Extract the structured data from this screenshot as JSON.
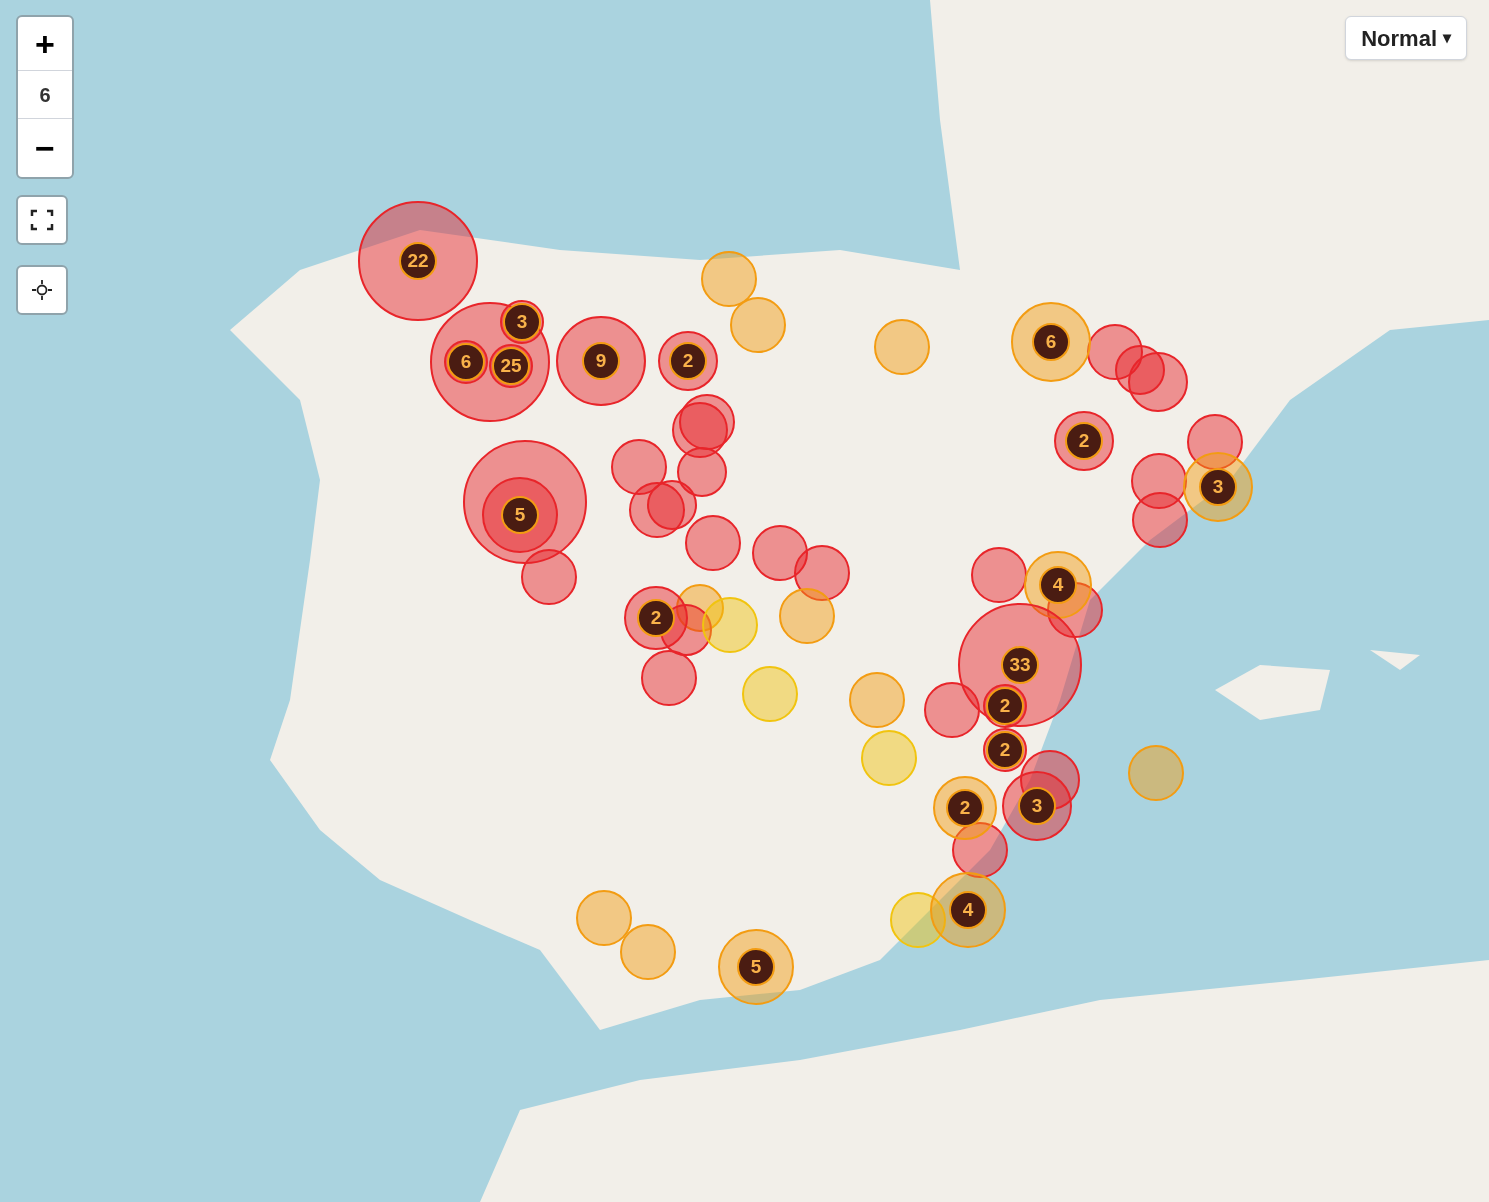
{
  "zoom_control": {
    "zoom_in": "+",
    "level": "6",
    "zoom_out": "−"
  },
  "layer_select": {
    "value": "Normal",
    "caret": "▾"
  },
  "markers": [
    {
      "color": "#e8252a",
      "count": "22"
    },
    {
      "color": "#e8252a"
    },
    {
      "color": "#e8252a",
      "count": "3"
    },
    {
      "color": "#e8252a",
      "count": "6"
    },
    {
      "color": "#e8252a",
      "count": "25"
    },
    {
      "color": "#e8252a",
      "count": "9"
    },
    {
      "color": "#e8252a",
      "count": "2"
    },
    {
      "color": "#f39c12"
    },
    {
      "color": "#f39c12"
    },
    {
      "color": "#f39c12"
    },
    {
      "color": "#f39c12",
      "count": "6"
    },
    {
      "color": "#e8252a"
    },
    {
      "color": "#e8252a"
    },
    {
      "color": "#e8252a"
    },
    {
      "color": "#e8252a",
      "count": "2"
    },
    {
      "color": "#e8252a"
    },
    {
      "color": "#e8252a"
    },
    {
      "color": "#e8252a"
    },
    {
      "color": "#f39c12",
      "count": "3"
    },
    {
      "color": "#e8252a"
    },
    {
      "color": "#e8252a"
    },
    {
      "color": "#e8252a"
    },
    {
      "color": "#e8252a"
    },
    {
      "color": "#e8252a"
    },
    {
      "color": "#e8252a"
    },
    {
      "color": "#e8252a"
    },
    {
      "color": "#e8252a"
    },
    {
      "color": "#e8252a",
      "count": "5"
    },
    {
      "color": "#e8252a"
    },
    {
      "color": "#f39c12"
    },
    {
      "color": "#e8252a",
      "count": "2"
    },
    {
      "color": "#e8252a"
    },
    {
      "color": "#f1c40f"
    },
    {
      "color": "#e8252a"
    },
    {
      "color": "#e8252a"
    },
    {
      "color": "#f39c12"
    },
    {
      "color": "#e8252a"
    },
    {
      "color": "#f1c40f"
    },
    {
      "color": "#f39c12"
    },
    {
      "color": "#f1c40f"
    },
    {
      "color": "#e8252a"
    },
    {
      "color": "#f39c12",
      "count": "4"
    },
    {
      "color": "#e8252a"
    },
    {
      "color": "#e8252a",
      "count": "33"
    },
    {
      "color": "#e8252a"
    },
    {
      "color": "#e8252a",
      "count": "2"
    },
    {
      "color": "#e8252a",
      "count": "2"
    },
    {
      "color": "#f39c12"
    },
    {
      "color": "#e8252a"
    },
    {
      "color": "#f39c12",
      "count": "2"
    },
    {
      "color": "#e8252a",
      "count": "3"
    },
    {
      "color": "#e8252a"
    },
    {
      "color": "#f1c40f"
    },
    {
      "color": "#f39c12",
      "count": "4"
    },
    {
      "color": "#f39c12"
    },
    {
      "color": "#f39c12"
    },
    {
      "color": "#f39c12",
      "count": "5"
    }
  ]
}
